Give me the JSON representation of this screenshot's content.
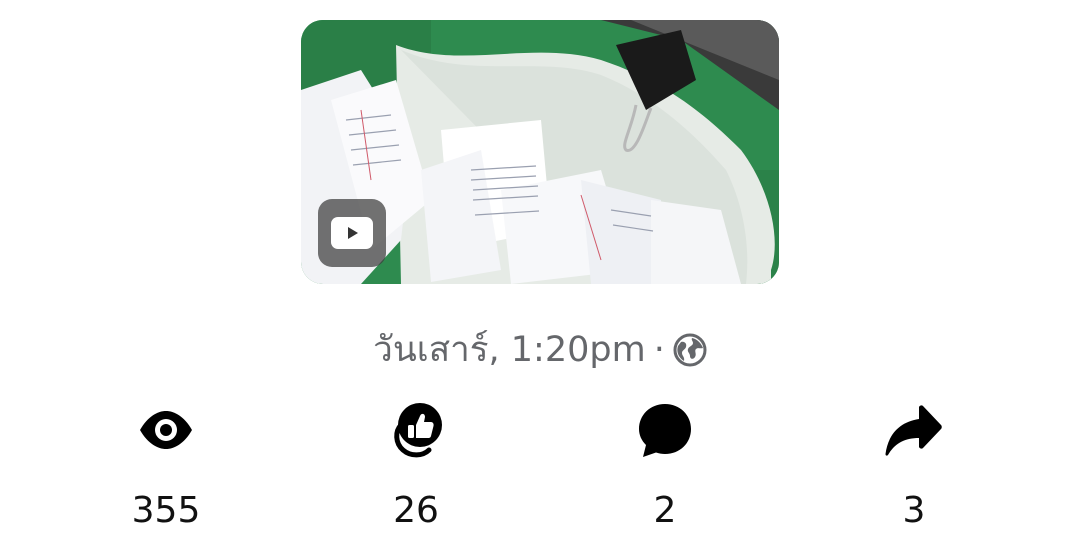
{
  "post": {
    "media": {
      "type": "video",
      "badge_icon": "video-play-icon"
    },
    "timestamp": "วันเสาร์, 1:20pm",
    "separator": "·",
    "privacy_icon": "globe-public-icon"
  },
  "stats": {
    "views": {
      "icon": "eye-icon",
      "count": "355"
    },
    "reactions": {
      "icon": "like-reaction-icon",
      "count": "26"
    },
    "comments": {
      "icon": "comment-bubble-icon",
      "count": "2"
    },
    "shares": {
      "icon": "share-arrow-icon",
      "count": "3"
    }
  },
  "colors": {
    "bin_green": "#2f8a4e",
    "icon": "#000000",
    "meta_text": "#65676b"
  }
}
